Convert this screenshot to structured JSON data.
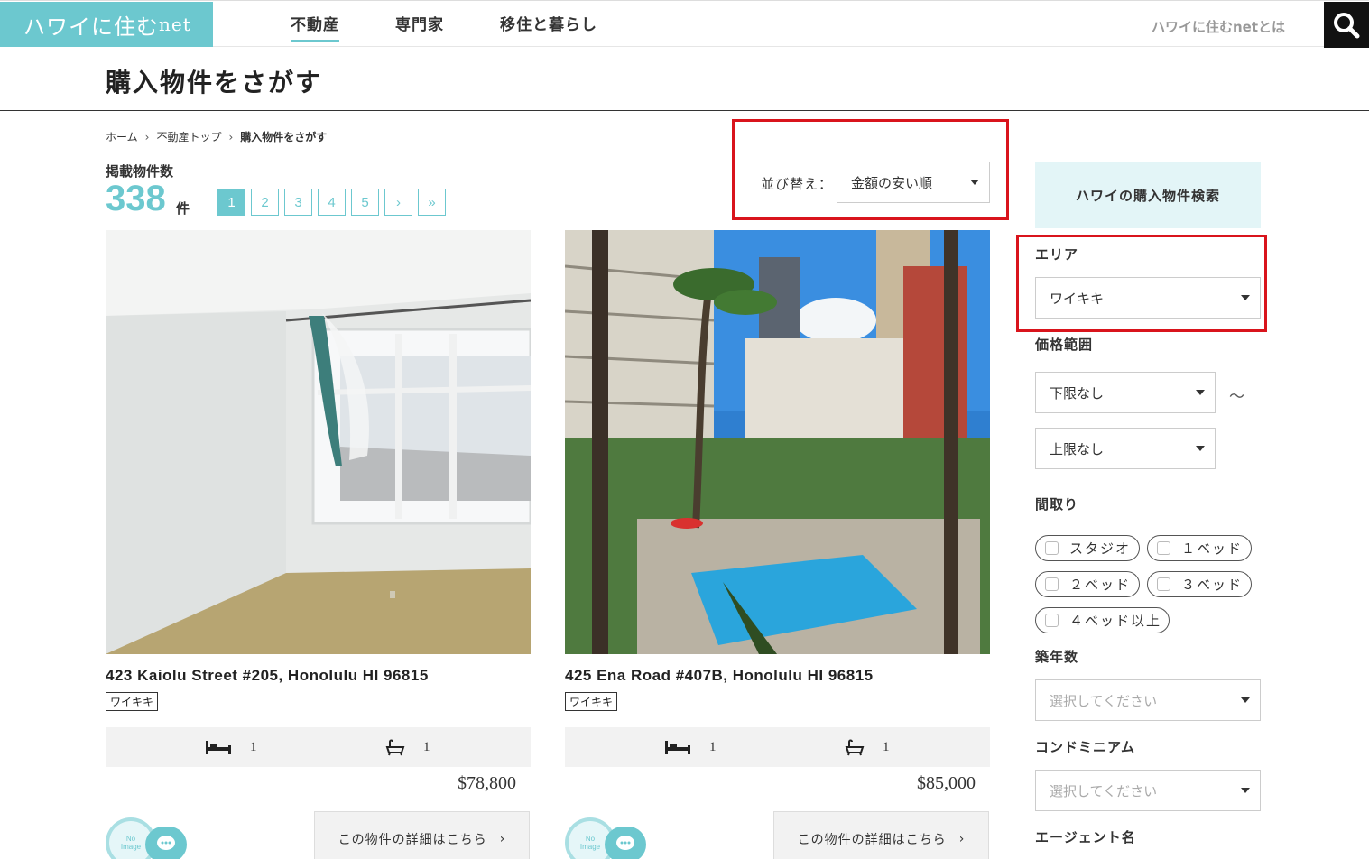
{
  "header": {
    "logo": "ハワイに住む",
    "logo_suffix": "net",
    "nav": [
      {
        "label": "不動産",
        "active": true
      },
      {
        "label": "専門家",
        "active": false
      },
      {
        "label": "移住と暮らし",
        "active": false
      }
    ],
    "about_link": "ハワイに住むnetとは",
    "search_icon": "search-icon"
  },
  "page": {
    "title": "購入物件をさがす"
  },
  "breadcrumb": {
    "items": [
      "ホーム",
      "不動産トップ",
      "購入物件をさがす"
    ],
    "separator": "›"
  },
  "listing_count": {
    "label": "掲載物件数",
    "value": "338",
    "unit": "件"
  },
  "pagination": {
    "pages": [
      "1",
      "2",
      "3",
      "4",
      "5"
    ],
    "next": "›",
    "last": "»",
    "current": "1"
  },
  "sort": {
    "label": "並び替え：",
    "selected": "金額の安い順"
  },
  "properties": [
    {
      "title": "423 Kaiolu Street #205, Honolulu HI 96815",
      "area_tag": "ワイキキ",
      "beds": "1",
      "baths": "1",
      "price": "$78,800",
      "detail_label": "この物件の詳細はこちら",
      "detail_arrow": "›",
      "avatar_text": "No Image"
    },
    {
      "title": "425 Ena Road #407B, Honolulu HI 96815",
      "area_tag": "ワイキキ",
      "beds": "1",
      "baths": "1",
      "price": "$85,000",
      "detail_label": "この物件の詳細はこちら",
      "detail_arrow": "›",
      "avatar_text": "No Image"
    }
  ],
  "sidebar": {
    "heading": "ハワイの購入物件検索",
    "area": {
      "label": "エリア",
      "selected": "ワイキキ"
    },
    "price": {
      "label": "価格範囲",
      "min": "下限なし",
      "max": "上限なし",
      "tilde": "～"
    },
    "layout": {
      "label": "間取り",
      "options": [
        "スタジオ",
        "１ベッド",
        "２ベッド",
        "３ベッド",
        "４ベッド以上"
      ]
    },
    "age": {
      "label": "築年数",
      "placeholder": "選択してください"
    },
    "condo": {
      "label": "コンドミニアム",
      "placeholder": "選択してください"
    },
    "agent": {
      "label": "エージェント名"
    }
  },
  "colors": {
    "accent": "#6cc8cf",
    "highlight": "#d9141c"
  }
}
